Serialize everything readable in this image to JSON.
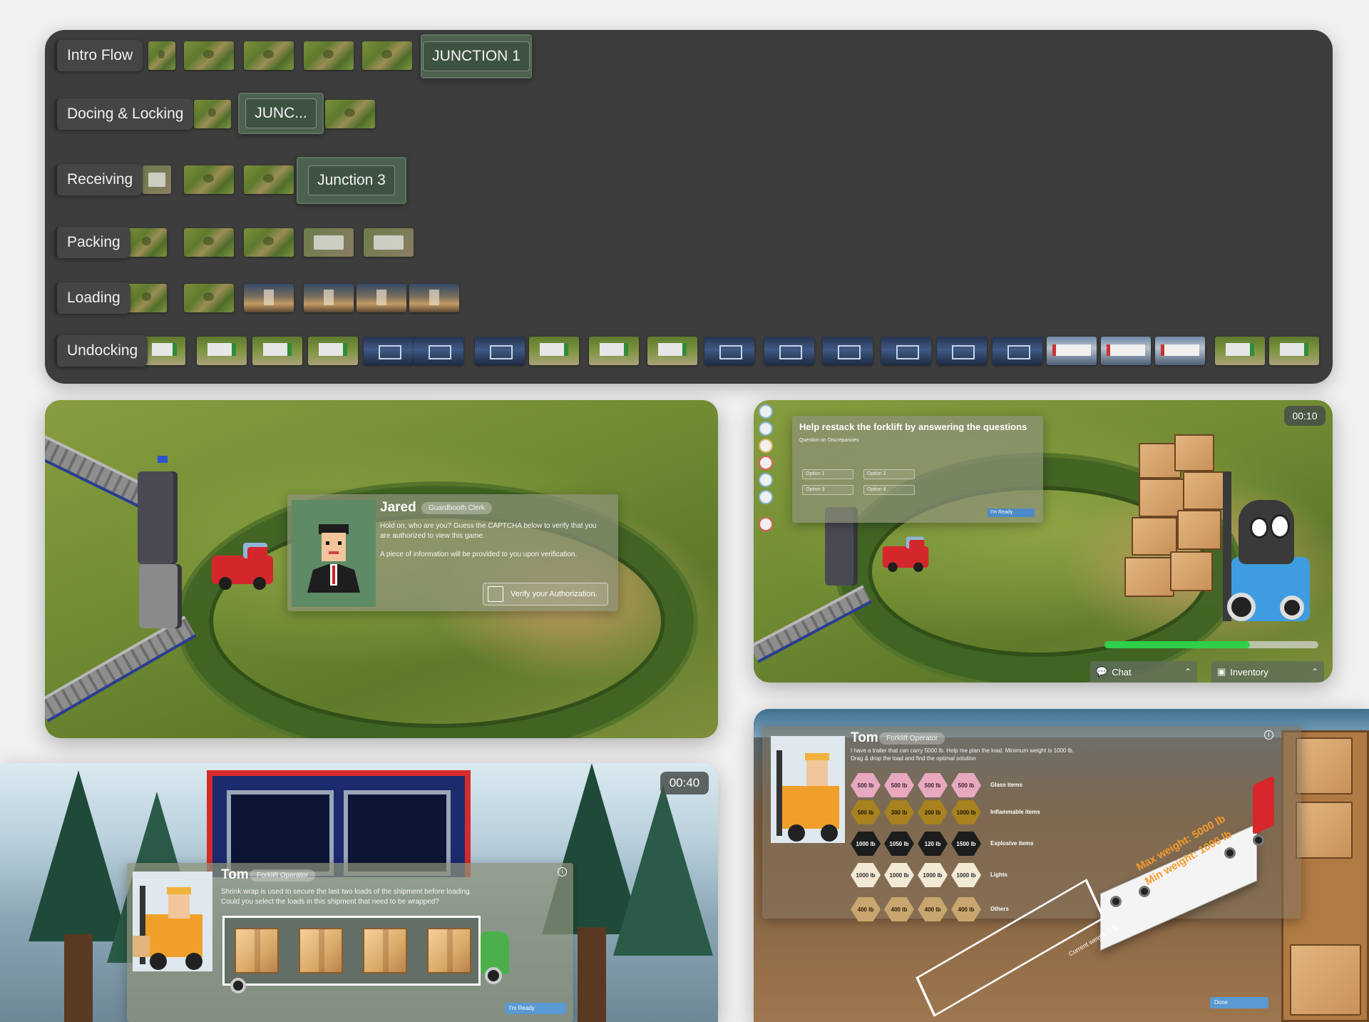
{
  "flow": {
    "rows": [
      {
        "label": "Intro Flow",
        "junction": "JUNCTION 1"
      },
      {
        "label": "Docing & Locking",
        "junction": "JUNC..."
      },
      {
        "label": "Receiving",
        "junction": "Junction 3"
      },
      {
        "label": "Packing"
      },
      {
        "label": "Loading"
      },
      {
        "label": "Undocking"
      }
    ]
  },
  "guard_scene": {
    "name": "Jared",
    "role": "Guardbooth Clerk",
    "message_1": "Hold on, who are you? Guess the CAPTCHA below to verify that you are authorized to view this game.",
    "message_2": "A piece of information will be provided to you upon verification.",
    "verify_label": "Verify your Authorization."
  },
  "forklift_scene": {
    "timer": "00:10",
    "question_title": "Help restack the forklift by answering the questions",
    "question_subtitle": "Question on Discrepancies",
    "options": [
      "Option 1",
      "Option 2",
      "Option 3",
      "Option 4"
    ],
    "ready_label": "I'm Ready",
    "progress": 0.68,
    "chat_label": "Chat",
    "inventory_label": "Inventory",
    "progress_color": "#2fcf4a"
  },
  "dock_scene": {
    "timer": "00:40",
    "name": "Tom",
    "role": "Forklift Operator",
    "message": "Shrink wrap is used to secure the last two loads of the shipment before loading. Could you select the loads in this shipment that need to be wrapped?",
    "ready_label": "I'm Ready",
    "box_count": 4
  },
  "load_scene": {
    "name": "Tom",
    "role": "Forklift Operator",
    "message": "I have a trailer that can carry 5000 lb. Help me plan the load. Minimum weight is 1000 lb. Drag & drop the load and find the optimal solution",
    "categories": [
      {
        "label": "Glass items",
        "color": "#e8a9c0",
        "text_color": "#3a2230",
        "weights": [
          "500 lb",
          "500 lb",
          "500 lb",
          "500 lb"
        ]
      },
      {
        "label": "Inflammable items",
        "color": "#a8821f",
        "text_color": "#1f1605",
        "weights": [
          "500 lb",
          "300 lb",
          "200 lb",
          "1000 lb"
        ]
      },
      {
        "label": "Explosive items",
        "color": "#1c1c1c",
        "text_color": "#ffffff",
        "weights": [
          "1000 lb",
          "1050 lb",
          "120 lb",
          "1500 lb"
        ]
      },
      {
        "label": "Lights",
        "color": "#f3ead6",
        "text_color": "#2a2a2a",
        "weights": [
          "1000 lb",
          "1000 lb",
          "1000 lb",
          "1000 lb"
        ]
      },
      {
        "label": "Others",
        "color": "#c9a66f",
        "text_color": "#2a1a08",
        "weights": [
          "400 lb",
          "400 lb",
          "400 lb",
          "400 lb"
        ]
      }
    ],
    "max_weight": "Max weight: 5000 lb",
    "min_weight": "Min weight: 1000 lb",
    "current_weight": "Current weight: 0 lb",
    "done_label": "Done"
  }
}
